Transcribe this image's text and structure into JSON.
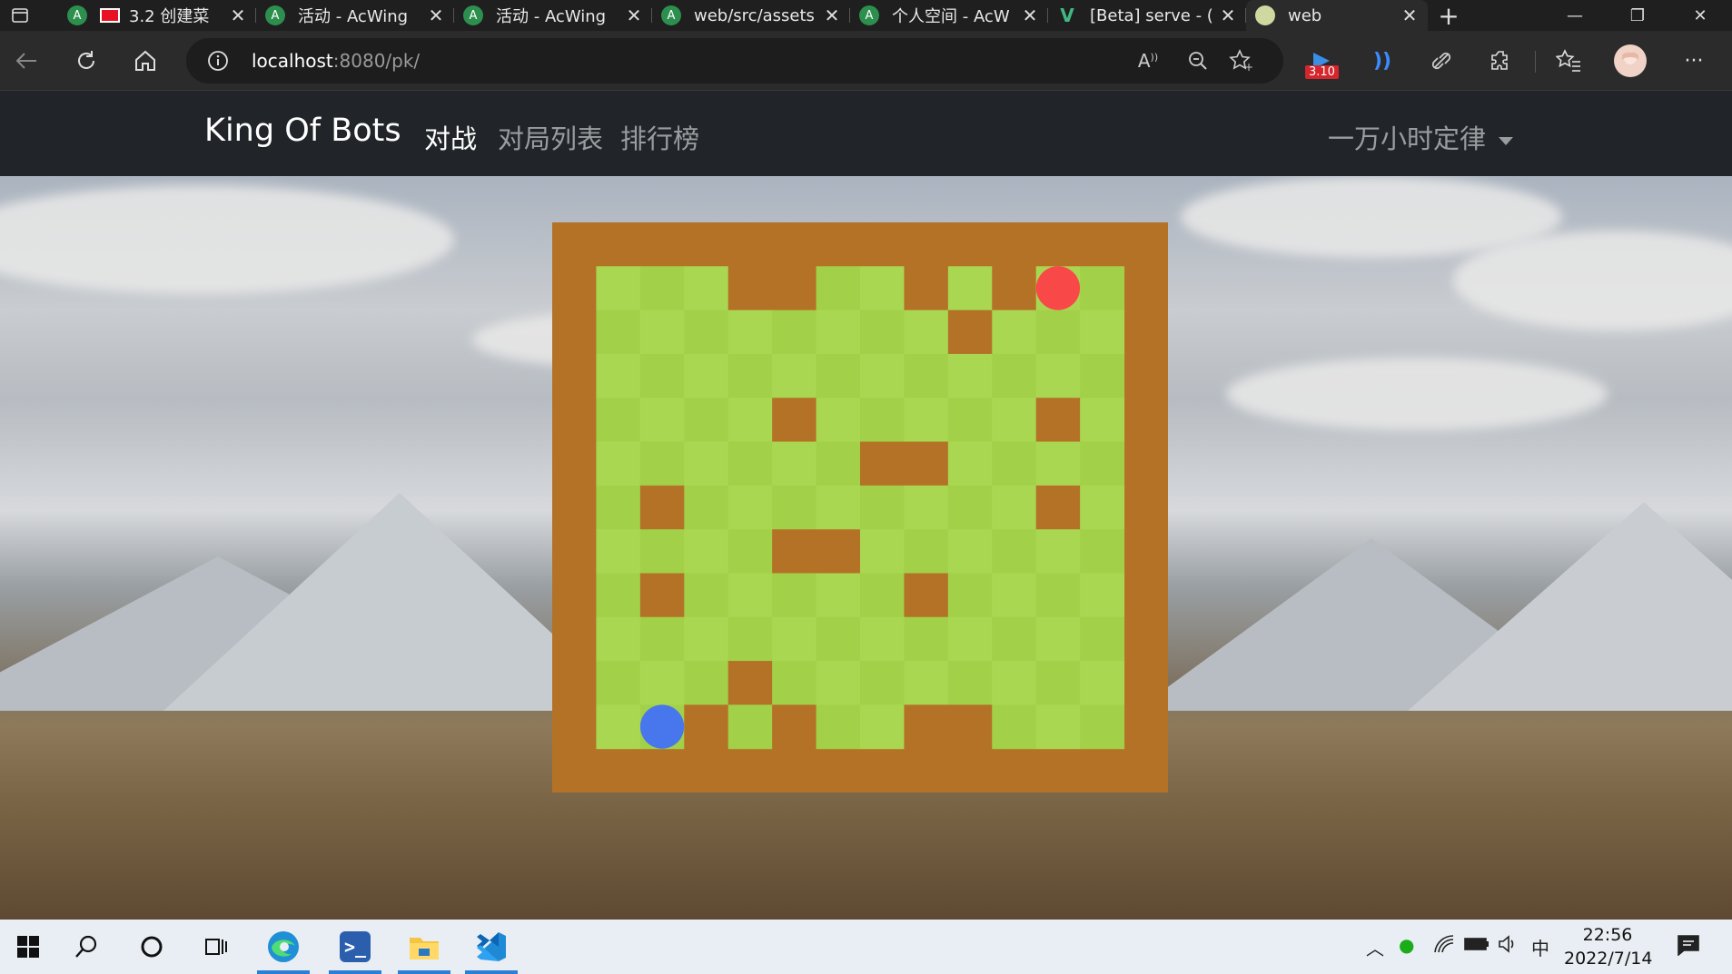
{
  "browser": {
    "tabs": [
      {
        "label": "3.2 创建菜",
        "icon": "recording-icon",
        "active": false
      },
      {
        "label": "活动 - AcWing",
        "icon": "acwing-icon",
        "active": false
      },
      {
        "label": "活动 - AcWing",
        "icon": "acwing-icon",
        "active": false
      },
      {
        "label": "web/src/assets",
        "icon": "acwing-icon",
        "active": false
      },
      {
        "label": "个人空间 - AcW",
        "icon": "acwing-icon",
        "active": false
      },
      {
        "label": "[Beta] serve - (",
        "icon": "vue-icon",
        "active": false
      },
      {
        "label": "web",
        "icon": "web-icon",
        "active": true
      }
    ],
    "new_tab_symbol": "+",
    "close_symbol": "✕",
    "url_host": "localhost",
    "url_rest": ":8080/pk/",
    "extension_badge": "3.10"
  },
  "app": {
    "brand": "King Of Bots",
    "nav": [
      {
        "label": "对战",
        "active": true
      },
      {
        "label": "对局列表",
        "active": false
      },
      {
        "label": "排行榜",
        "active": false
      }
    ],
    "username": "一万小时定律"
  },
  "game": {
    "rows": 11,
    "cols": 12,
    "colors": {
      "wall": "#B47226",
      "cell_even": "#AAD751",
      "cell_odd": "#A2D149",
      "snake_a": "#4876EC",
      "snake_b": "#F94848"
    },
    "inner_walls": [
      [
        0,
        3
      ],
      [
        0,
        4
      ],
      [
        0,
        7
      ],
      [
        0,
        9
      ],
      [
        1,
        8
      ],
      [
        3,
        4
      ],
      [
        3,
        10
      ],
      [
        4,
        6
      ],
      [
        4,
        7
      ],
      [
        5,
        1
      ],
      [
        5,
        10
      ],
      [
        6,
        4
      ],
      [
        6,
        5
      ],
      [
        7,
        1
      ],
      [
        7,
        7
      ],
      [
        9,
        3
      ],
      [
        10,
        2
      ],
      [
        10,
        4
      ],
      [
        10,
        7
      ],
      [
        10,
        8
      ]
    ],
    "snake_a": {
      "row": 10,
      "col": 1
    },
    "snake_b": {
      "row": 0,
      "col": 10
    }
  },
  "taskbar": {
    "apps": [
      "windows-start-icon",
      "search-icon",
      "cortana-icon",
      "task-view-icon",
      "edge-icon",
      "powershell-icon",
      "file-explorer-icon",
      "vscode-icon"
    ],
    "ime": "中",
    "time": "22:56",
    "date": "2022/7/14"
  }
}
